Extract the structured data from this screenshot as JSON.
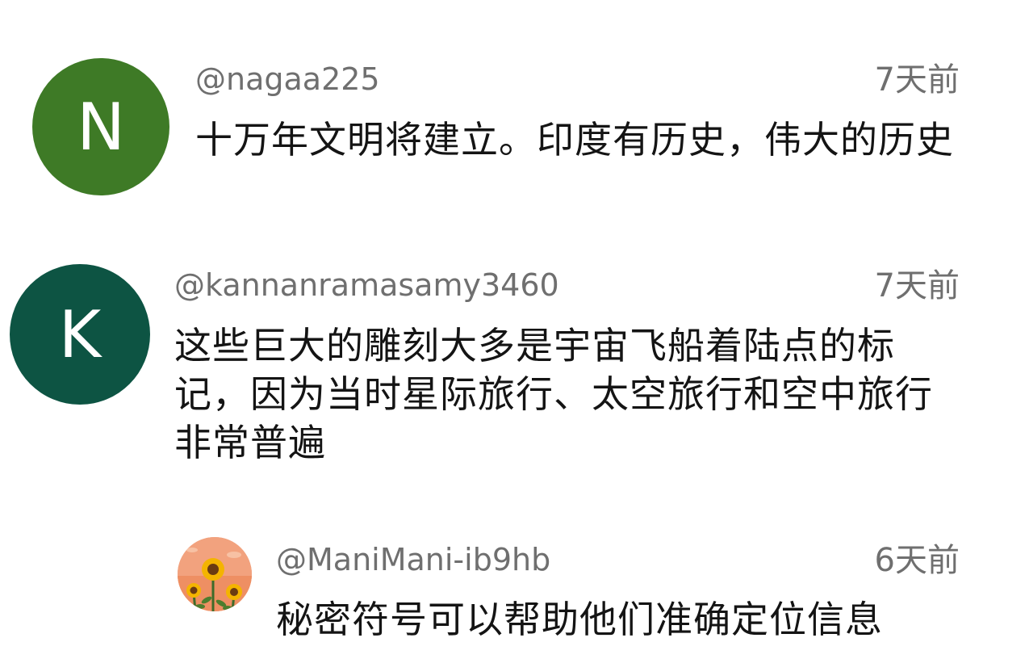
{
  "comments": [
    {
      "avatar_letter": "N",
      "avatar_color": "#3e7a26",
      "handle": "@nagaa225",
      "time": "7天前",
      "text": "十万年文明将建立。印度有历史，伟大的历史"
    },
    {
      "avatar_letter": "K",
      "avatar_color": "#0d5443",
      "handle": "@kannanramasamy3460",
      "time": "7天前",
      "text": "这些巨大的雕刻大多是宇宙飞船着陆点的标记，因为当时星际旅行、太空旅行和空中旅行非常普遍"
    },
    {
      "avatar_icon": "sunflower-avatar-icon",
      "handle": "@ManiMani-ib9hb",
      "time": "6天前",
      "text": "秘密符号可以帮助他们准确定位信息"
    }
  ]
}
